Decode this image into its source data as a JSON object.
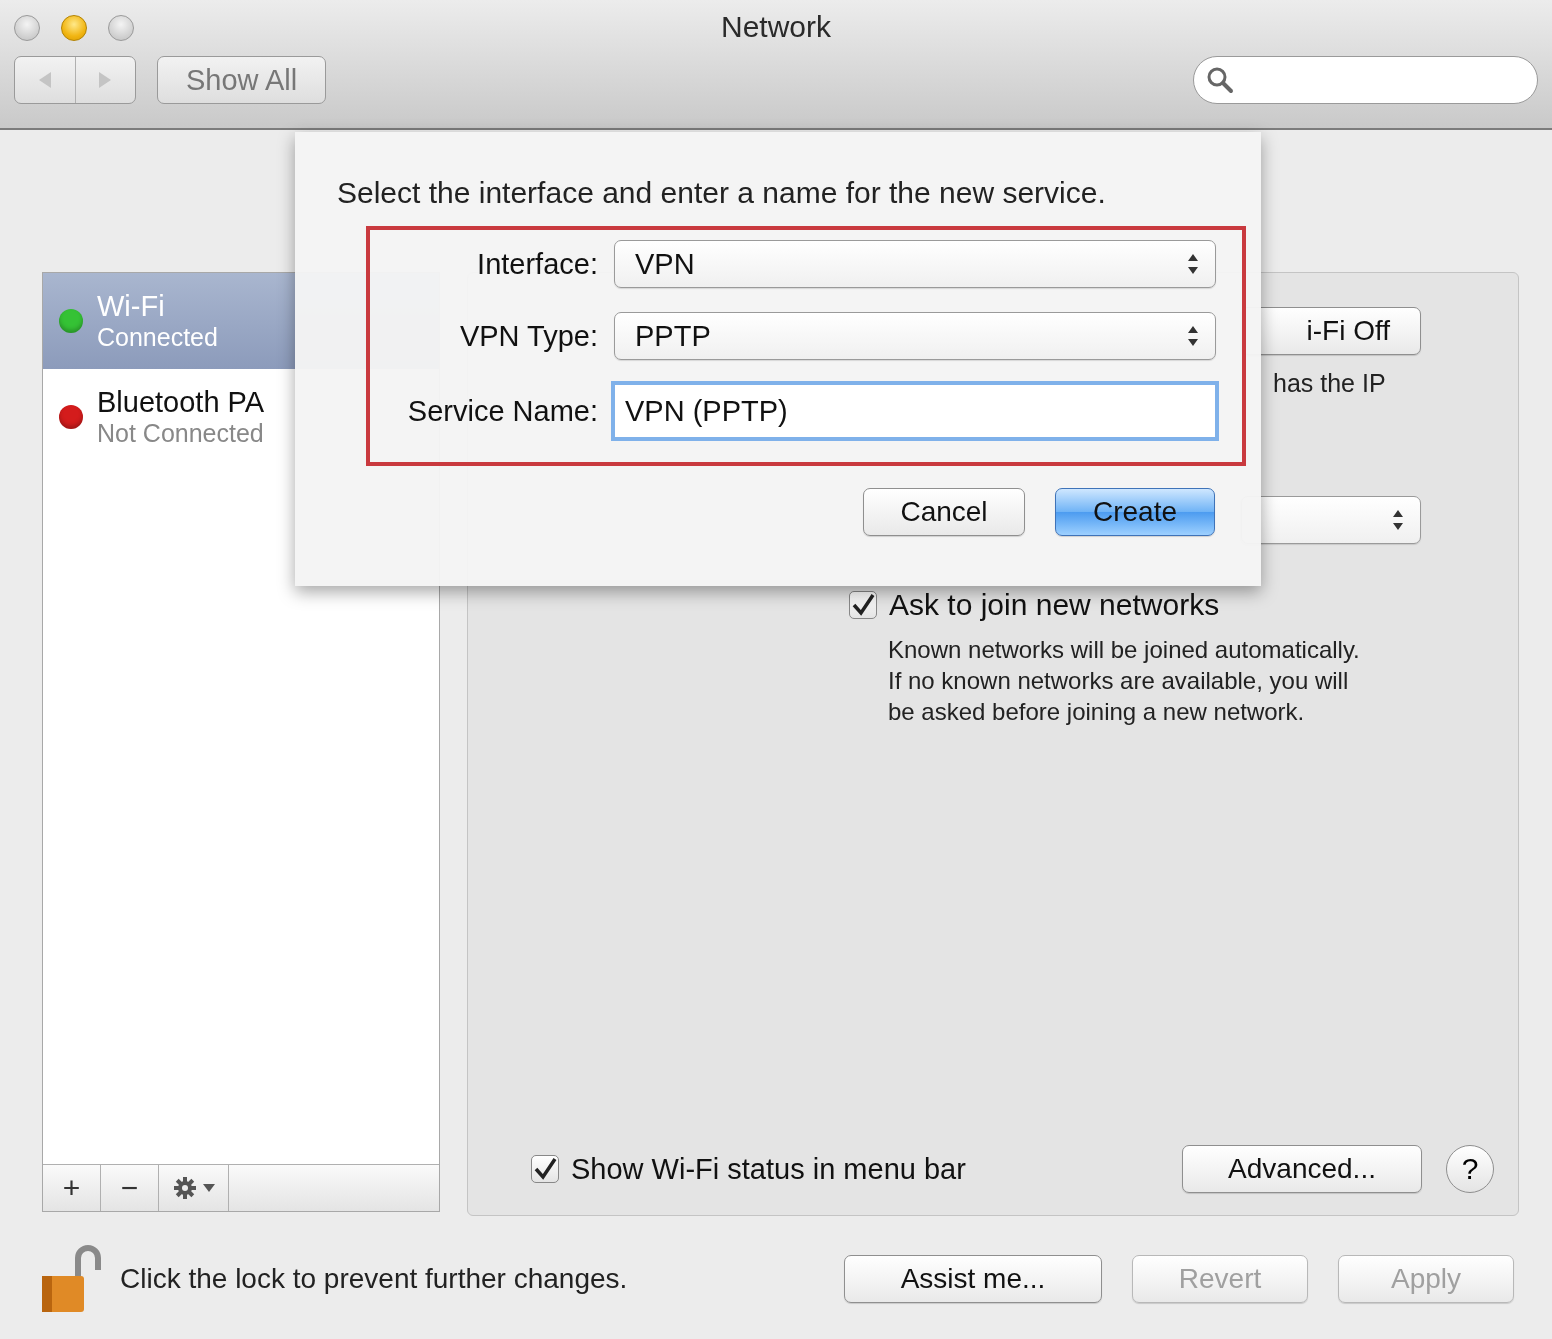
{
  "window": {
    "title": "Network",
    "show_all": "Show All"
  },
  "services": [
    {
      "name": "Wi-Fi",
      "status": "Connected",
      "color": "#35c235",
      "selected": true
    },
    {
      "name": "Bluetooth PA",
      "status": "Not Connected",
      "color": "#d41c1c",
      "selected": false
    }
  ],
  "list_buttons": [
    "+",
    "−"
  ],
  "wifi_panel": {
    "power_button": "i-Fi Off",
    "status_fragment": "has the IP",
    "ask_to_join": {
      "label": "Ask to join new networks",
      "checked": true,
      "description_lines": [
        "Known networks will be joined automatically.",
        "If no known networks are available, you will",
        "be asked before joining a new network."
      ]
    },
    "show_status": {
      "label": "Show Wi-Fi status in menu bar",
      "checked": true
    },
    "advanced_button": "Advanced...",
    "help_button": "?"
  },
  "sheet": {
    "prompt": "Select the interface and enter a name for the new service.",
    "fields": [
      {
        "kind": "popup",
        "label": "Interface:",
        "value": "VPN"
      },
      {
        "kind": "popup",
        "label": "VPN Type:",
        "value": "PPTP"
      },
      {
        "kind": "text",
        "label": "Service Name:",
        "value": "VPN (PPTP)",
        "focused": true
      }
    ],
    "buttons": [
      {
        "label": "Cancel",
        "default": false
      },
      {
        "label": "Create",
        "default": true
      }
    ]
  },
  "footer": {
    "lock_text": "Click the lock to prevent further changes.",
    "buttons": [
      {
        "label": "Assist me...",
        "disabled": false
      },
      {
        "label": "Revert",
        "disabled": true
      },
      {
        "label": "Apply",
        "disabled": true
      }
    ]
  }
}
